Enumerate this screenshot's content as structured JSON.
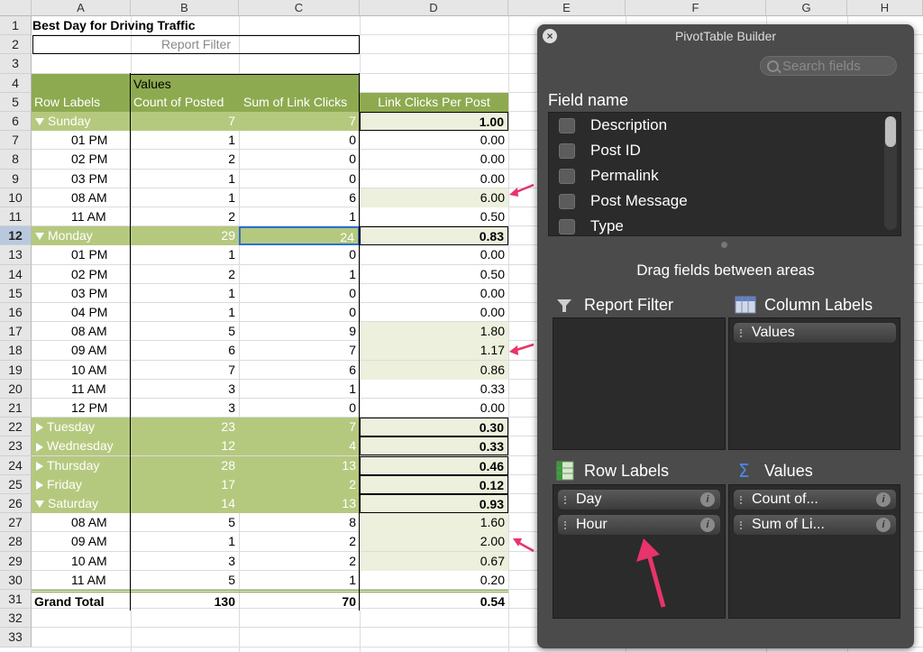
{
  "columns": [
    "A",
    "B",
    "C",
    "D",
    "E",
    "F",
    "G",
    "H"
  ],
  "title": "Best Day for Driving Traffic",
  "report_filter": "Report Filter",
  "headers": {
    "values": "Values",
    "row_labels": "Row Labels",
    "count_posted": "Count of Posted",
    "sum_clicks": "Sum of Link Clicks",
    "clicks_per_post": "Link Clicks Per Post"
  },
  "rows": [
    {
      "n": "1"
    },
    {
      "n": "2"
    },
    {
      "n": "3"
    },
    {
      "n": "4"
    },
    {
      "n": "5"
    },
    {
      "n": "6",
      "type": "group",
      "expanded": true,
      "label": "Sunday",
      "count": "7",
      "sum": "7",
      "per": "1.00"
    },
    {
      "n": "7",
      "label": "01 PM",
      "count": "1",
      "sum": "0",
      "per": "0.00"
    },
    {
      "n": "8",
      "label": "02 PM",
      "count": "2",
      "sum": "0",
      "per": "0.00"
    },
    {
      "n": "9",
      "label": "03 PM",
      "count": "1",
      "sum": "0",
      "per": "0.00"
    },
    {
      "n": "10",
      "label": "08 AM",
      "count": "1",
      "sum": "6",
      "per": "6.00",
      "hl": true
    },
    {
      "n": "11",
      "label": "11 AM",
      "count": "2",
      "sum": "1",
      "per": "0.50"
    },
    {
      "n": "12",
      "type": "group",
      "expanded": true,
      "label": "Monday",
      "count": "29",
      "sum": "24",
      "per": "0.83"
    },
    {
      "n": "13",
      "label": "01 PM",
      "count": "1",
      "sum": "0",
      "per": "0.00"
    },
    {
      "n": "14",
      "label": "02 PM",
      "count": "2",
      "sum": "1",
      "per": "0.50"
    },
    {
      "n": "15",
      "label": "03 PM",
      "count": "1",
      "sum": "0",
      "per": "0.00"
    },
    {
      "n": "16",
      "label": "04 PM",
      "count": "1",
      "sum": "0",
      "per": "0.00"
    },
    {
      "n": "17",
      "label": "08 AM",
      "count": "5",
      "sum": "9",
      "per": "1.80",
      "hl": true
    },
    {
      "n": "18",
      "label": "09 AM",
      "count": "6",
      "sum": "7",
      "per": "1.17",
      "hl": true
    },
    {
      "n": "19",
      "label": "10 AM",
      "count": "7",
      "sum": "6",
      "per": "0.86",
      "hl": true
    },
    {
      "n": "20",
      "label": "11 AM",
      "count": "3",
      "sum": "1",
      "per": "0.33"
    },
    {
      "n": "21",
      "label": "12 PM",
      "count": "3",
      "sum": "0",
      "per": "0.00"
    },
    {
      "n": "22",
      "type": "group",
      "expanded": false,
      "label": "Tuesday",
      "count": "23",
      "sum": "7",
      "per": "0.30"
    },
    {
      "n": "23",
      "type": "group",
      "expanded": false,
      "label": "Wednesday",
      "count": "12",
      "sum": "4",
      "per": "0.33"
    },
    {
      "n": "24",
      "type": "group",
      "expanded": false,
      "label": "Thursday",
      "count": "28",
      "sum": "13",
      "per": "0.46"
    },
    {
      "n": "25",
      "type": "group",
      "expanded": false,
      "label": "Friday",
      "count": "17",
      "sum": "2",
      "per": "0.12"
    },
    {
      "n": "26",
      "type": "group",
      "expanded": true,
      "label": "Saturday",
      "count": "14",
      "sum": "13",
      "per": "0.93"
    },
    {
      "n": "27",
      "label": "08 AM",
      "count": "5",
      "sum": "8",
      "per": "1.60",
      "hl": true
    },
    {
      "n": "28",
      "label": "09 AM",
      "count": "1",
      "sum": "2",
      "per": "2.00",
      "hl": true
    },
    {
      "n": "29",
      "label": "10 AM",
      "count": "3",
      "sum": "2",
      "per": "0.67",
      "hl": true
    },
    {
      "n": "30",
      "label": "11 AM",
      "count": "5",
      "sum": "1",
      "per": "0.20"
    },
    {
      "n": "31",
      "type": "total",
      "label": "Grand Total",
      "count": "130",
      "sum": "70",
      "per": "0.54"
    },
    {
      "n": "32"
    },
    {
      "n": "33"
    }
  ],
  "builder": {
    "title": "PivotTable Builder",
    "search_placeholder": "Search fields",
    "field_name_label": "Field name",
    "fields": [
      "Description",
      "Post ID",
      "Permalink",
      "Post Message",
      "Type"
    ],
    "drag_hint": "Drag fields between areas",
    "report_filter_label": "Report Filter",
    "column_labels_label": "Column Labels",
    "row_labels_label": "Row Labels",
    "values_label": "Values",
    "column_pills": [
      "Values"
    ],
    "row_pills": [
      "Day",
      "Hour"
    ],
    "value_pills": [
      "Count of...",
      "Sum of Li..."
    ],
    "close_glyph": "×",
    "info_glyph": "i"
  },
  "colors": {
    "green_header": "#8eaa50",
    "green_light": "#d6e0b4",
    "pale_highlight": "#ecf0dc",
    "annotation_arrow": "#e8336b",
    "builder_bg": "#4b4b4b"
  }
}
